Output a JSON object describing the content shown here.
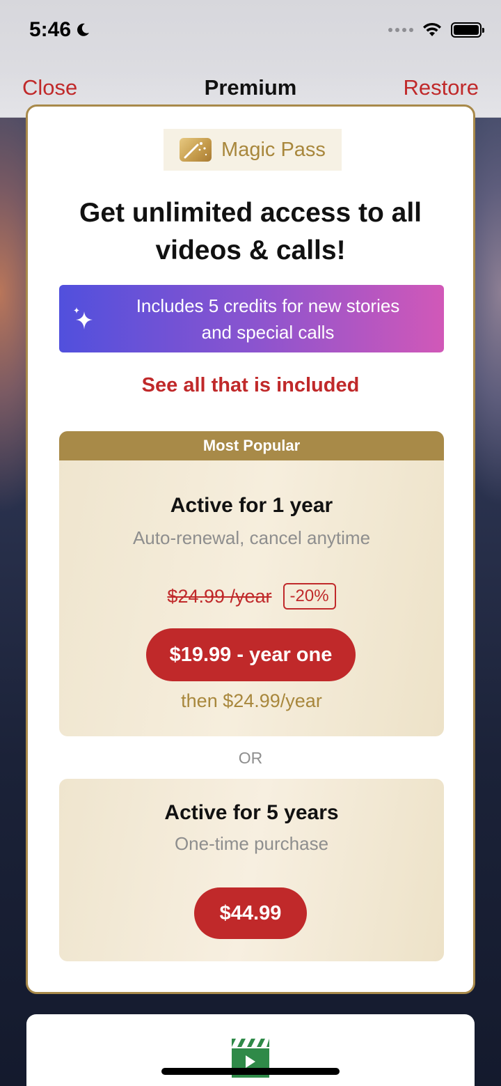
{
  "status_bar": {
    "time": "5:46"
  },
  "nav": {
    "close_label": "Close",
    "title": "Premium",
    "restore_label": "Restore"
  },
  "badge": {
    "label": "Magic Pass",
    "icon": "magic-wand-icon"
  },
  "headline": "Get unlimited access to all videos & calls!",
  "credits_banner": {
    "line1": "Includes 5 credits for new stories",
    "line2": "and special calls",
    "icon": "sparkle-icon"
  },
  "see_all_label": "See all that is included",
  "plans": [
    {
      "ribbon": "Most Popular",
      "title": "Active for 1 year",
      "subtitle": "Auto-renewal, cancel anytime",
      "old_price": "$24.99 /year",
      "discount": "-20%",
      "price_button": "$19.99 - year one",
      "then_text": "then $24.99/year"
    },
    {
      "title": "Active for 5 years",
      "subtitle": "One-time purchase",
      "price_button": "$44.99"
    }
  ],
  "or_label": "OR",
  "colors": {
    "accent_red": "#c0292a",
    "gold": "#a8894a",
    "banner_start": "#5150dd",
    "banner_end": "#d158b8"
  }
}
